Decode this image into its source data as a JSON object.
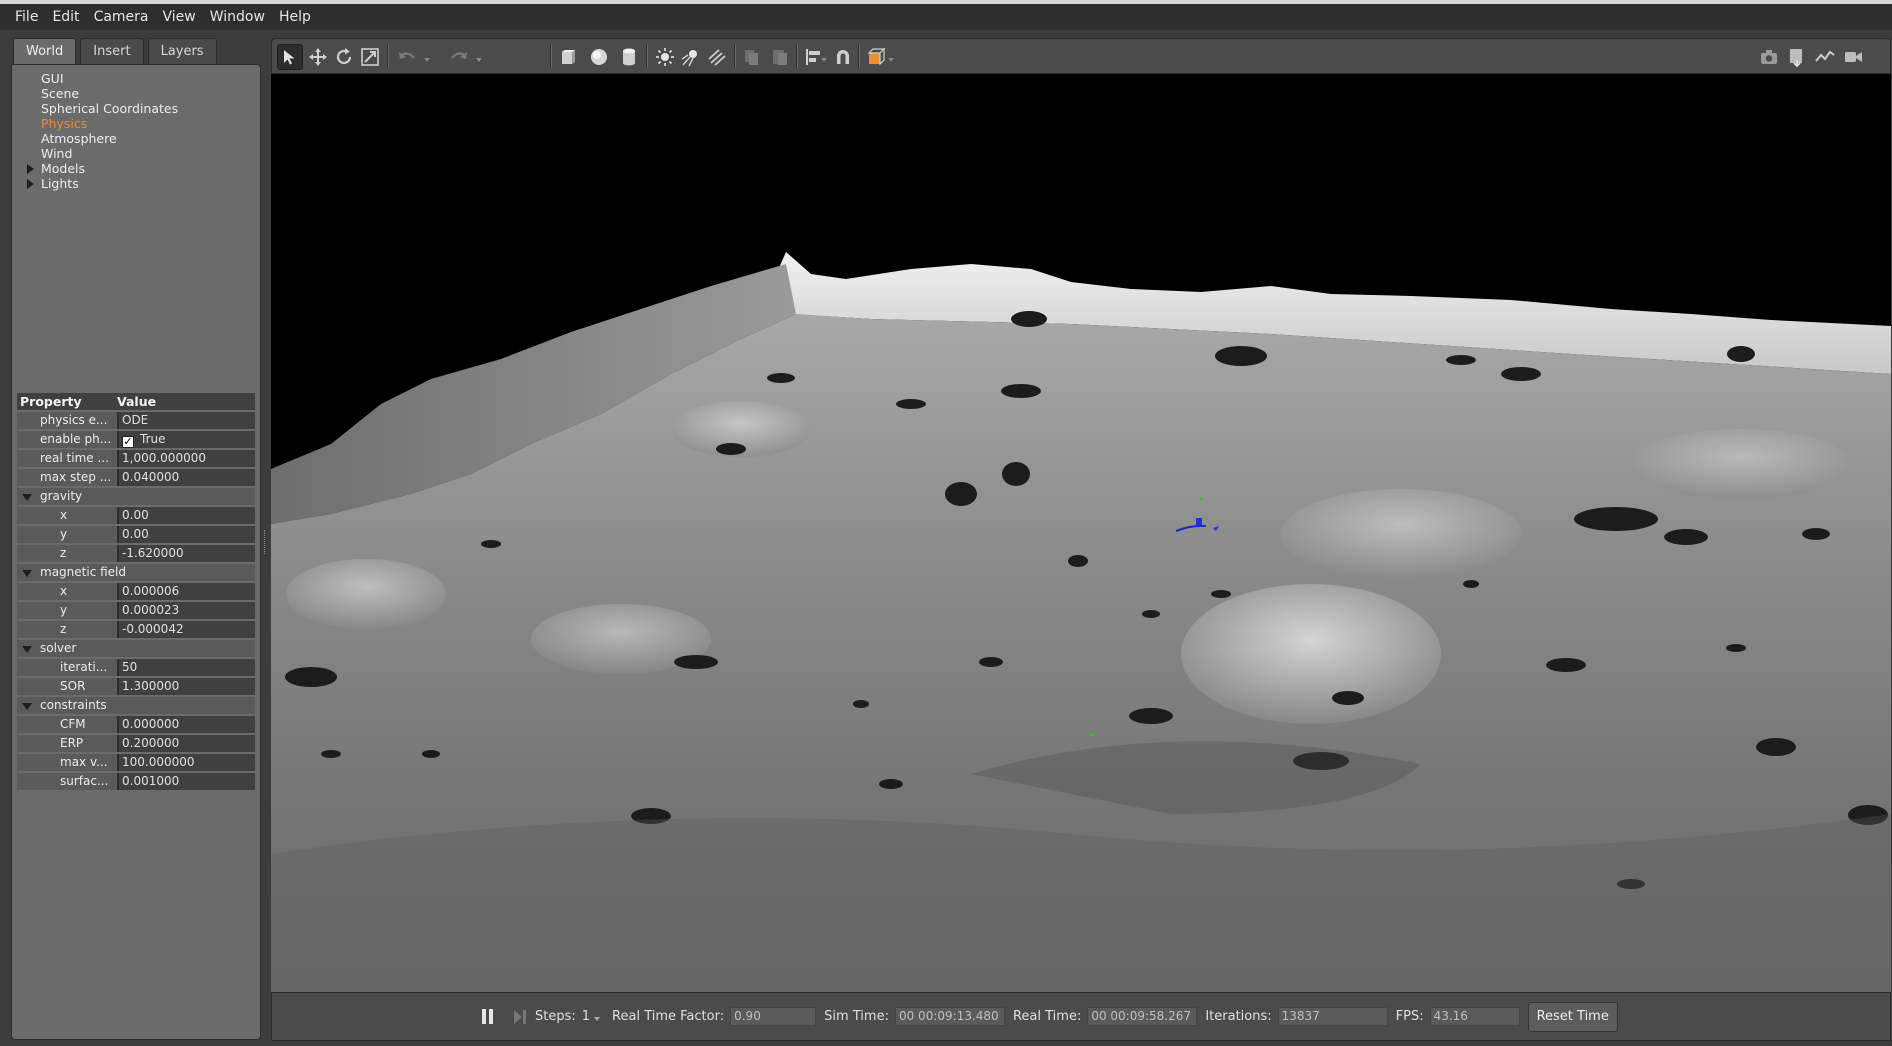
{
  "menu": [
    "File",
    "Edit",
    "Camera",
    "View",
    "Window",
    "Help"
  ],
  "tabs": [
    {
      "label": "World",
      "active": true
    },
    {
      "label": "Insert",
      "active": false
    },
    {
      "label": "Layers",
      "active": false
    }
  ],
  "tree": [
    {
      "label": "GUI",
      "expandable": false,
      "selected": false
    },
    {
      "label": "Scene",
      "expandable": false,
      "selected": false
    },
    {
      "label": "Spherical Coordinates",
      "expandable": false,
      "selected": false
    },
    {
      "label": "Physics",
      "expandable": false,
      "selected": true
    },
    {
      "label": "Atmosphere",
      "expandable": false,
      "selected": false
    },
    {
      "label": "Wind",
      "expandable": false,
      "selected": false
    },
    {
      "label": "Models",
      "expandable": true,
      "selected": false
    },
    {
      "label": "Lights",
      "expandable": true,
      "selected": false
    }
  ],
  "properties": {
    "header": {
      "property": "Property",
      "value": "Value"
    },
    "physics_engine": {
      "key": "physics e...",
      "value": "ODE"
    },
    "enable_physics": {
      "key": "enable ph...",
      "value": "True",
      "checked": true
    },
    "real_time": {
      "key": "real time ...",
      "value": "1,000.000000"
    },
    "max_step": {
      "key": "max step ...",
      "value": "0.040000"
    },
    "gravity": {
      "key": "gravity",
      "x": "0.00",
      "y": "0.00",
      "z": "-1.620000"
    },
    "magnetic_field": {
      "key": "magnetic field",
      "x": "0.000006",
      "y": "0.000023",
      "z": "-0.000042"
    },
    "solver": {
      "key": "solver",
      "iterations_key": "iterati...",
      "iterations": "50",
      "sor_key": "SOR",
      "sor": "1.300000"
    },
    "constraints": {
      "key": "constraints",
      "cfm_key": "CFM",
      "cfm": "0.000000",
      "erp_key": "ERP",
      "erp": "0.200000",
      "maxv_key": "max v...",
      "maxv": "100.000000",
      "surface_key": "surfac...",
      "surface": "0.001000"
    },
    "axis": {
      "x": "x",
      "y": "y",
      "z": "z"
    }
  },
  "toolbar": {
    "icons": [
      "select-arrow-icon",
      "translate-icon",
      "rotate-icon",
      "scale-icon",
      "undo-icon",
      "redo-icon",
      "box-icon",
      "sphere-icon",
      "cylinder-icon",
      "point-light-icon",
      "spot-light-icon",
      "directional-light-icon",
      "copy-icon",
      "paste-icon",
      "align-icon",
      "snap-magnet-icon",
      "view-angle-icon",
      "screenshot-icon",
      "log-icon",
      "plot-icon",
      "video-record-icon"
    ],
    "accent": "#e8902e"
  },
  "status": {
    "steps_label": "Steps:",
    "steps_value": "1",
    "rtf_label": "Real Time Factor:",
    "rtf_value": "0.90",
    "sim_time_label": "Sim Time:",
    "sim_time_value": "00 00:09:13.480",
    "real_time_label": "Real Time:",
    "real_time_value": "00 00:09:58.267",
    "iterations_label": "Iterations:",
    "iterations_value": "13837",
    "fps_label": "FPS:",
    "fps_value": "43.16",
    "reset_label": "Reset Time"
  }
}
